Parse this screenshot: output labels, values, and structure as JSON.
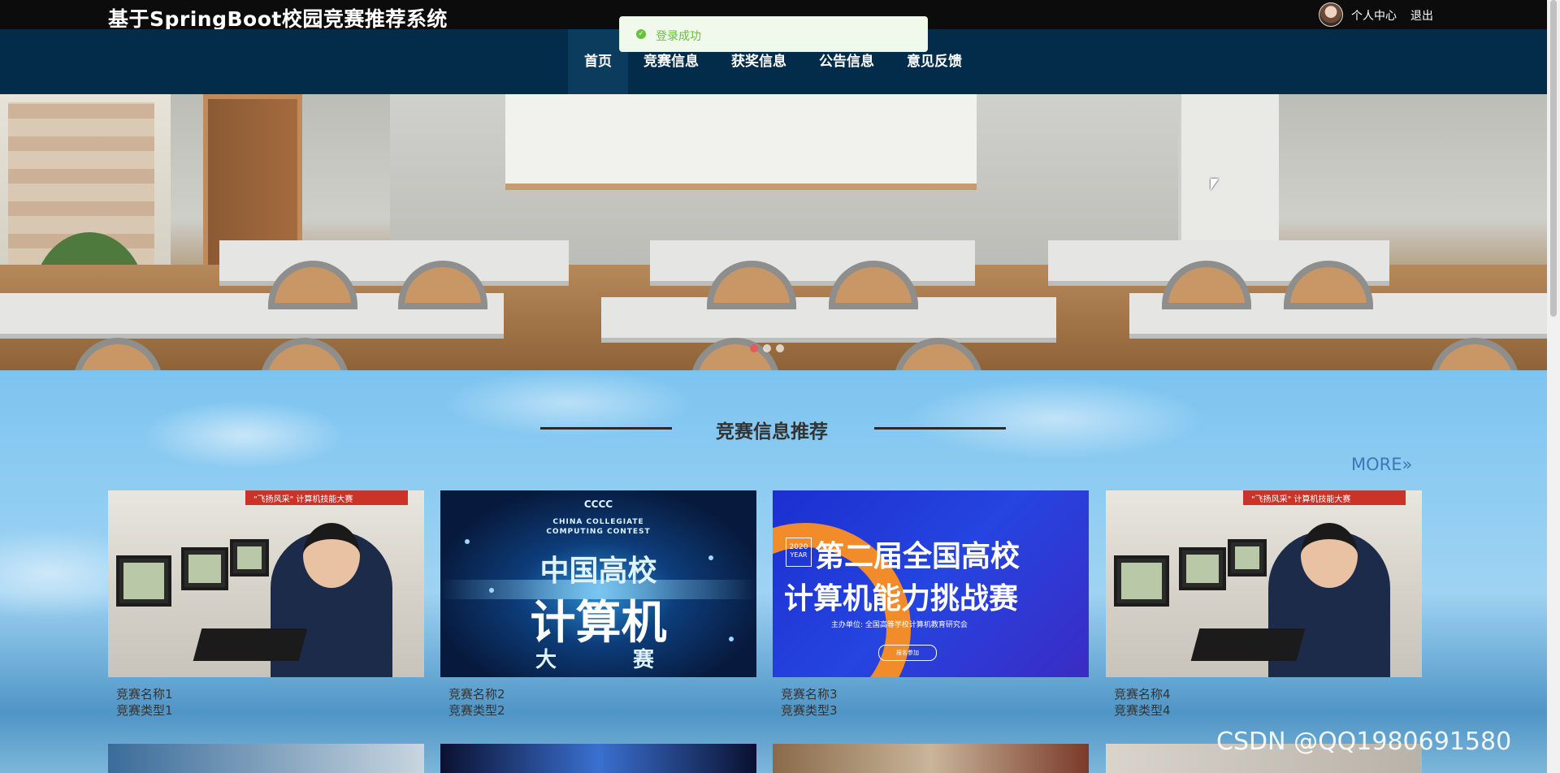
{
  "header": {
    "site_title": "基于SpringBoot校园竞赛推荐系统",
    "user_center": "个人中心",
    "logout": "退出"
  },
  "toast": {
    "message": "登录成功",
    "status_color": "#67c23a"
  },
  "nav": {
    "items": [
      {
        "label": "首页",
        "active": true
      },
      {
        "label": "竞赛信息",
        "active": false
      },
      {
        "label": "获奖信息",
        "active": false
      },
      {
        "label": "公告信息",
        "active": false
      },
      {
        "label": "意见反馈",
        "active": false
      }
    ]
  },
  "carousel": {
    "slide_count": 3,
    "active_index": 0,
    "active_color": "#e35b5b"
  },
  "section": {
    "title": "竞赛信息推荐",
    "more": "MORE",
    "more_icon": "double-chevron-right-icon",
    "cards": [
      {
        "name": "竞赛名称1",
        "type": "竞赛类型1"
      },
      {
        "name": "竞赛名称2",
        "type": "竞赛类型2"
      },
      {
        "name": "竞赛名称3",
        "type": "竞赛类型3"
      },
      {
        "name": "竞赛名称4",
        "type": "竞赛类型4"
      }
    ]
  },
  "images": {
    "lab_banner": "\"飞扬风采\" 计算机技能大赛",
    "ccc_logo": "CCCC",
    "ccc_en_1": "CHINA COLLEGIATE",
    "ccc_en_2": "COMPUTING CONTEST",
    "ccc_cn_1": "中国高校",
    "ccc_cn_2": "计算机",
    "ccc_cn_3": "大",
    "ccc_cn_4": "赛",
    "chal_year": "2020",
    "chal_year_label": "YEAR",
    "chal_line_1": "第二届全国高校",
    "chal_line_2": "计算机能力挑战赛",
    "chal_org": "主办单位: 全国高等学校计算机教育研究会",
    "chal_btn": "报名参加"
  },
  "watermark": "CSDN @QQ1980691580",
  "colors": {
    "nav_bg": "#032b4a",
    "topbar_bg": "#0c0c0c",
    "more_color": "#3a78b8"
  }
}
